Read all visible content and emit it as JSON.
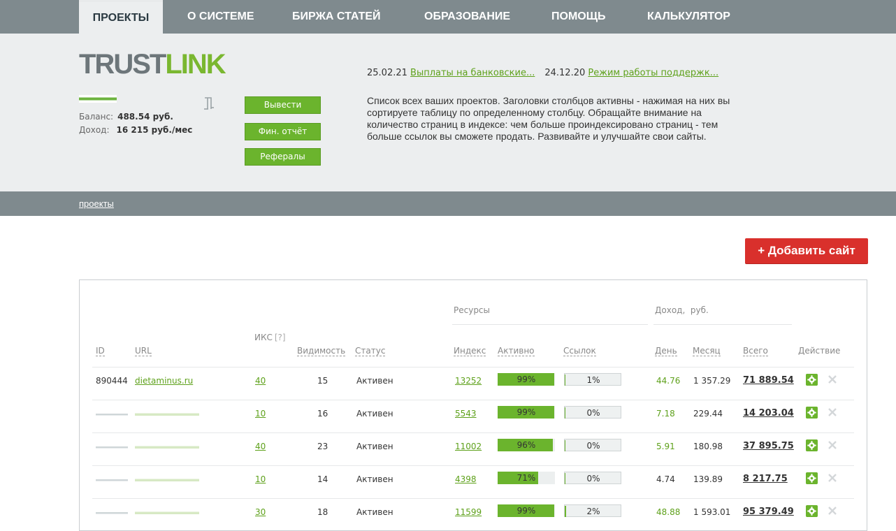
{
  "nav": {
    "tabs": [
      {
        "label": "ПРОЕКТЫ",
        "active": true
      },
      {
        "label": "О СИСТЕМЕ"
      },
      {
        "label": "БИРЖА СТАТЕЙ"
      },
      {
        "label": "ОБРАЗОВАНИЕ"
      },
      {
        "label": "ПОМОЩЬ"
      },
      {
        "label": "КАЛЬКУЛЯТОР"
      }
    ]
  },
  "logo": {
    "trust": "TRUST",
    "link": "LINK"
  },
  "account": {
    "balance_label": "Баланс:",
    "balance_value": "488.54 руб.",
    "income_label": "Доход:",
    "income_value": "16 215 руб./мес"
  },
  "buttons": {
    "withdraw": "Вывести",
    "report": "Фин. отчёт",
    "referrals": "Рефералы"
  },
  "news": [
    {
      "date": "25.02.21",
      "title": "Выплаты на банковские..."
    },
    {
      "date": "24.12.20",
      "title": "Режим работы поддержк..."
    }
  ],
  "description": "Список всех ваших проектов. Заголовки столбцов активны - нажимая на них вы сортируете таблицу по определенному столбцу. Обращайте внимание на количество страниц в индексе: чем больше проиндексировано страниц - тем больше ссылок вы сможете продать. Развивайте и улучшайте свои сайты.",
  "breadcrumb": "проекты",
  "add_site": "+ Добавить сайт",
  "table": {
    "group_resources": "Ресурсы",
    "group_income": "Доход,  руб.",
    "ikc_label": "ИКС",
    "ikc_help": "[?]",
    "headers": {
      "id": "ID",
      "url": "URL",
      "visibility": "Видимость",
      "status": "Статус",
      "index": "Индекс",
      "active": "Активно",
      "links": "Ссылок",
      "day": "День",
      "month": "Месяц",
      "total": "Всего",
      "action": "Действие"
    },
    "rows": [
      {
        "id": "890444",
        "url": "dietaminus.ru",
        "ikc": "40",
        "visibility": "15",
        "status": "Активен",
        "index": "13252",
        "active_pct": 99,
        "active_label": "99%",
        "links_pct": 1,
        "links_label": "1%",
        "day": "44.76",
        "day_green": true,
        "month": "1 357.29",
        "total": "71 889.54",
        "masked": false
      },
      {
        "id": "",
        "url": "",
        "ikc": "10",
        "visibility": "16",
        "status": "Активен",
        "index": "5543",
        "active_pct": 99,
        "active_label": "99%",
        "links_pct": 0,
        "links_label": "0%",
        "day": "7.18",
        "day_green": true,
        "month": "229.44",
        "total": "14 203.04",
        "masked": true
      },
      {
        "id": "",
        "url": "",
        "ikc": "40",
        "visibility": "23",
        "status": "Активен",
        "index": "11002",
        "active_pct": 96,
        "active_label": "96%",
        "links_pct": 0,
        "links_label": "0%",
        "day": "5.91",
        "day_green": true,
        "month": "180.98",
        "total": "37 895.75",
        "masked": true
      },
      {
        "id": "",
        "url": "",
        "ikc": "10",
        "visibility": "14",
        "status": "Активен",
        "index": "4398",
        "active_pct": 71,
        "active_label": "71%",
        "links_pct": 0,
        "links_label": "0%",
        "day": "4.74",
        "day_green": false,
        "month": "139.89",
        "total": "8 217.75",
        "masked": true
      },
      {
        "id": "",
        "url": "",
        "ikc": "30",
        "visibility": "18",
        "status": "Активен",
        "index": "11599",
        "active_pct": 99,
        "active_label": "99%",
        "links_pct": 2,
        "links_label": "2%",
        "day": "48.88",
        "day_green": true,
        "month": "1 593.01",
        "total": "95 379.49",
        "masked": true
      }
    ]
  },
  "colors": {
    "nav_bg": "#7f8a8e",
    "header_bg": "#eceeef",
    "accent_green": "#6bb42d",
    "link_green": "#5ea11b",
    "add_button_red": "#d9302c"
  }
}
